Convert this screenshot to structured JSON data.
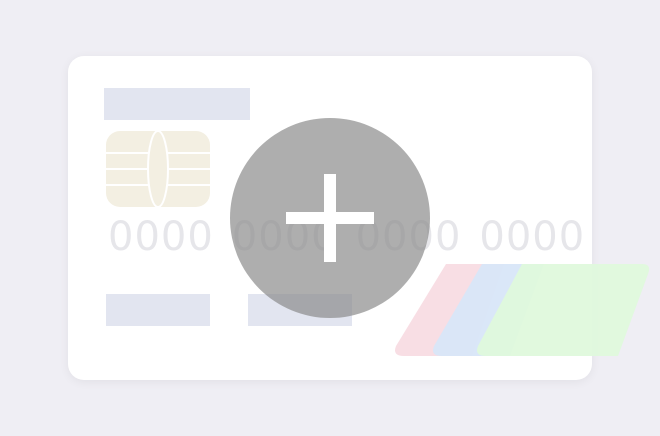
{
  "card": {
    "number_groups": [
      "0000",
      "0000",
      "0000",
      "0000"
    ]
  },
  "add_button": {
    "icon": "plus-icon"
  },
  "network_logos": {
    "colors": [
      "#f8dce3",
      "#d8e6f8",
      "#dff9dc"
    ]
  },
  "colors": {
    "background": "#efeef4",
    "card": "#ffffff",
    "placeholder_bar": "#e2e5f0",
    "chip": "#f3efe2",
    "overlay": "#8c8c8c"
  }
}
